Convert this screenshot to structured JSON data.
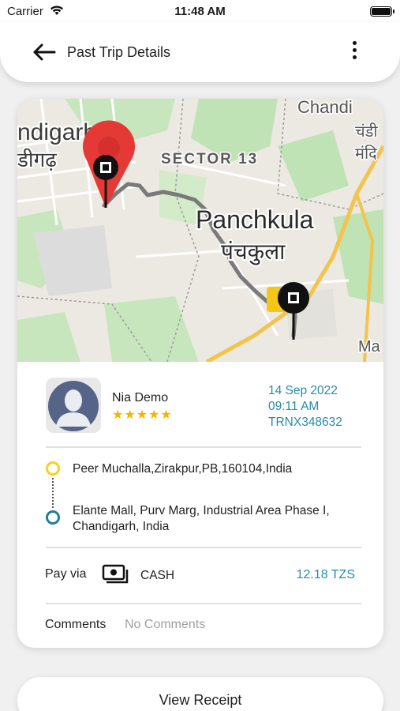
{
  "status_bar": {
    "carrier": "Carrier",
    "time": "11:48 AM"
  },
  "header": {
    "title": "Past Trip Details"
  },
  "map": {
    "labels": {
      "chandigarh_en": "ndigarh",
      "chandigarh_hi": "डीगढ़",
      "sector": "SECTOR 13",
      "panchkula_en": "Panchkula",
      "panchkula_hi": "पंचकुला",
      "chandi_en": "Chandi",
      "chandi_hi": "चंडी",
      "mandir_hi": "मंदि",
      "ma": "Ma"
    },
    "colors": {
      "land": "#ece9e2",
      "park": "#bfe3b4",
      "road": "#ffffff",
      "highway": "#f3c34c",
      "route": "#7a7a7a",
      "pin_start": "#e53935",
      "pin_end_badge": "#f5c518"
    }
  },
  "driver": {
    "name": "Nia Demo",
    "stars": "★★★★★",
    "rating": 5
  },
  "trip": {
    "date": "14 Sep 2022",
    "time": "09:11 AM",
    "transaction_id": "TRNX348632"
  },
  "route": {
    "pickup": "Peer Muchalla,Zirakpur,PB,160104,India",
    "drop": "Elante Mall, Purv Marg, Industrial Area Phase I, Chandigarh, India"
  },
  "payment": {
    "label": "Pay via",
    "method": "CASH",
    "amount": "12.18 TZS",
    "icon": "cash-icon"
  },
  "comments": {
    "label": "Comments",
    "value": "No Comments"
  },
  "actions": {
    "view_receipt": "View Receipt"
  },
  "accent_color": "#2a8aa8"
}
